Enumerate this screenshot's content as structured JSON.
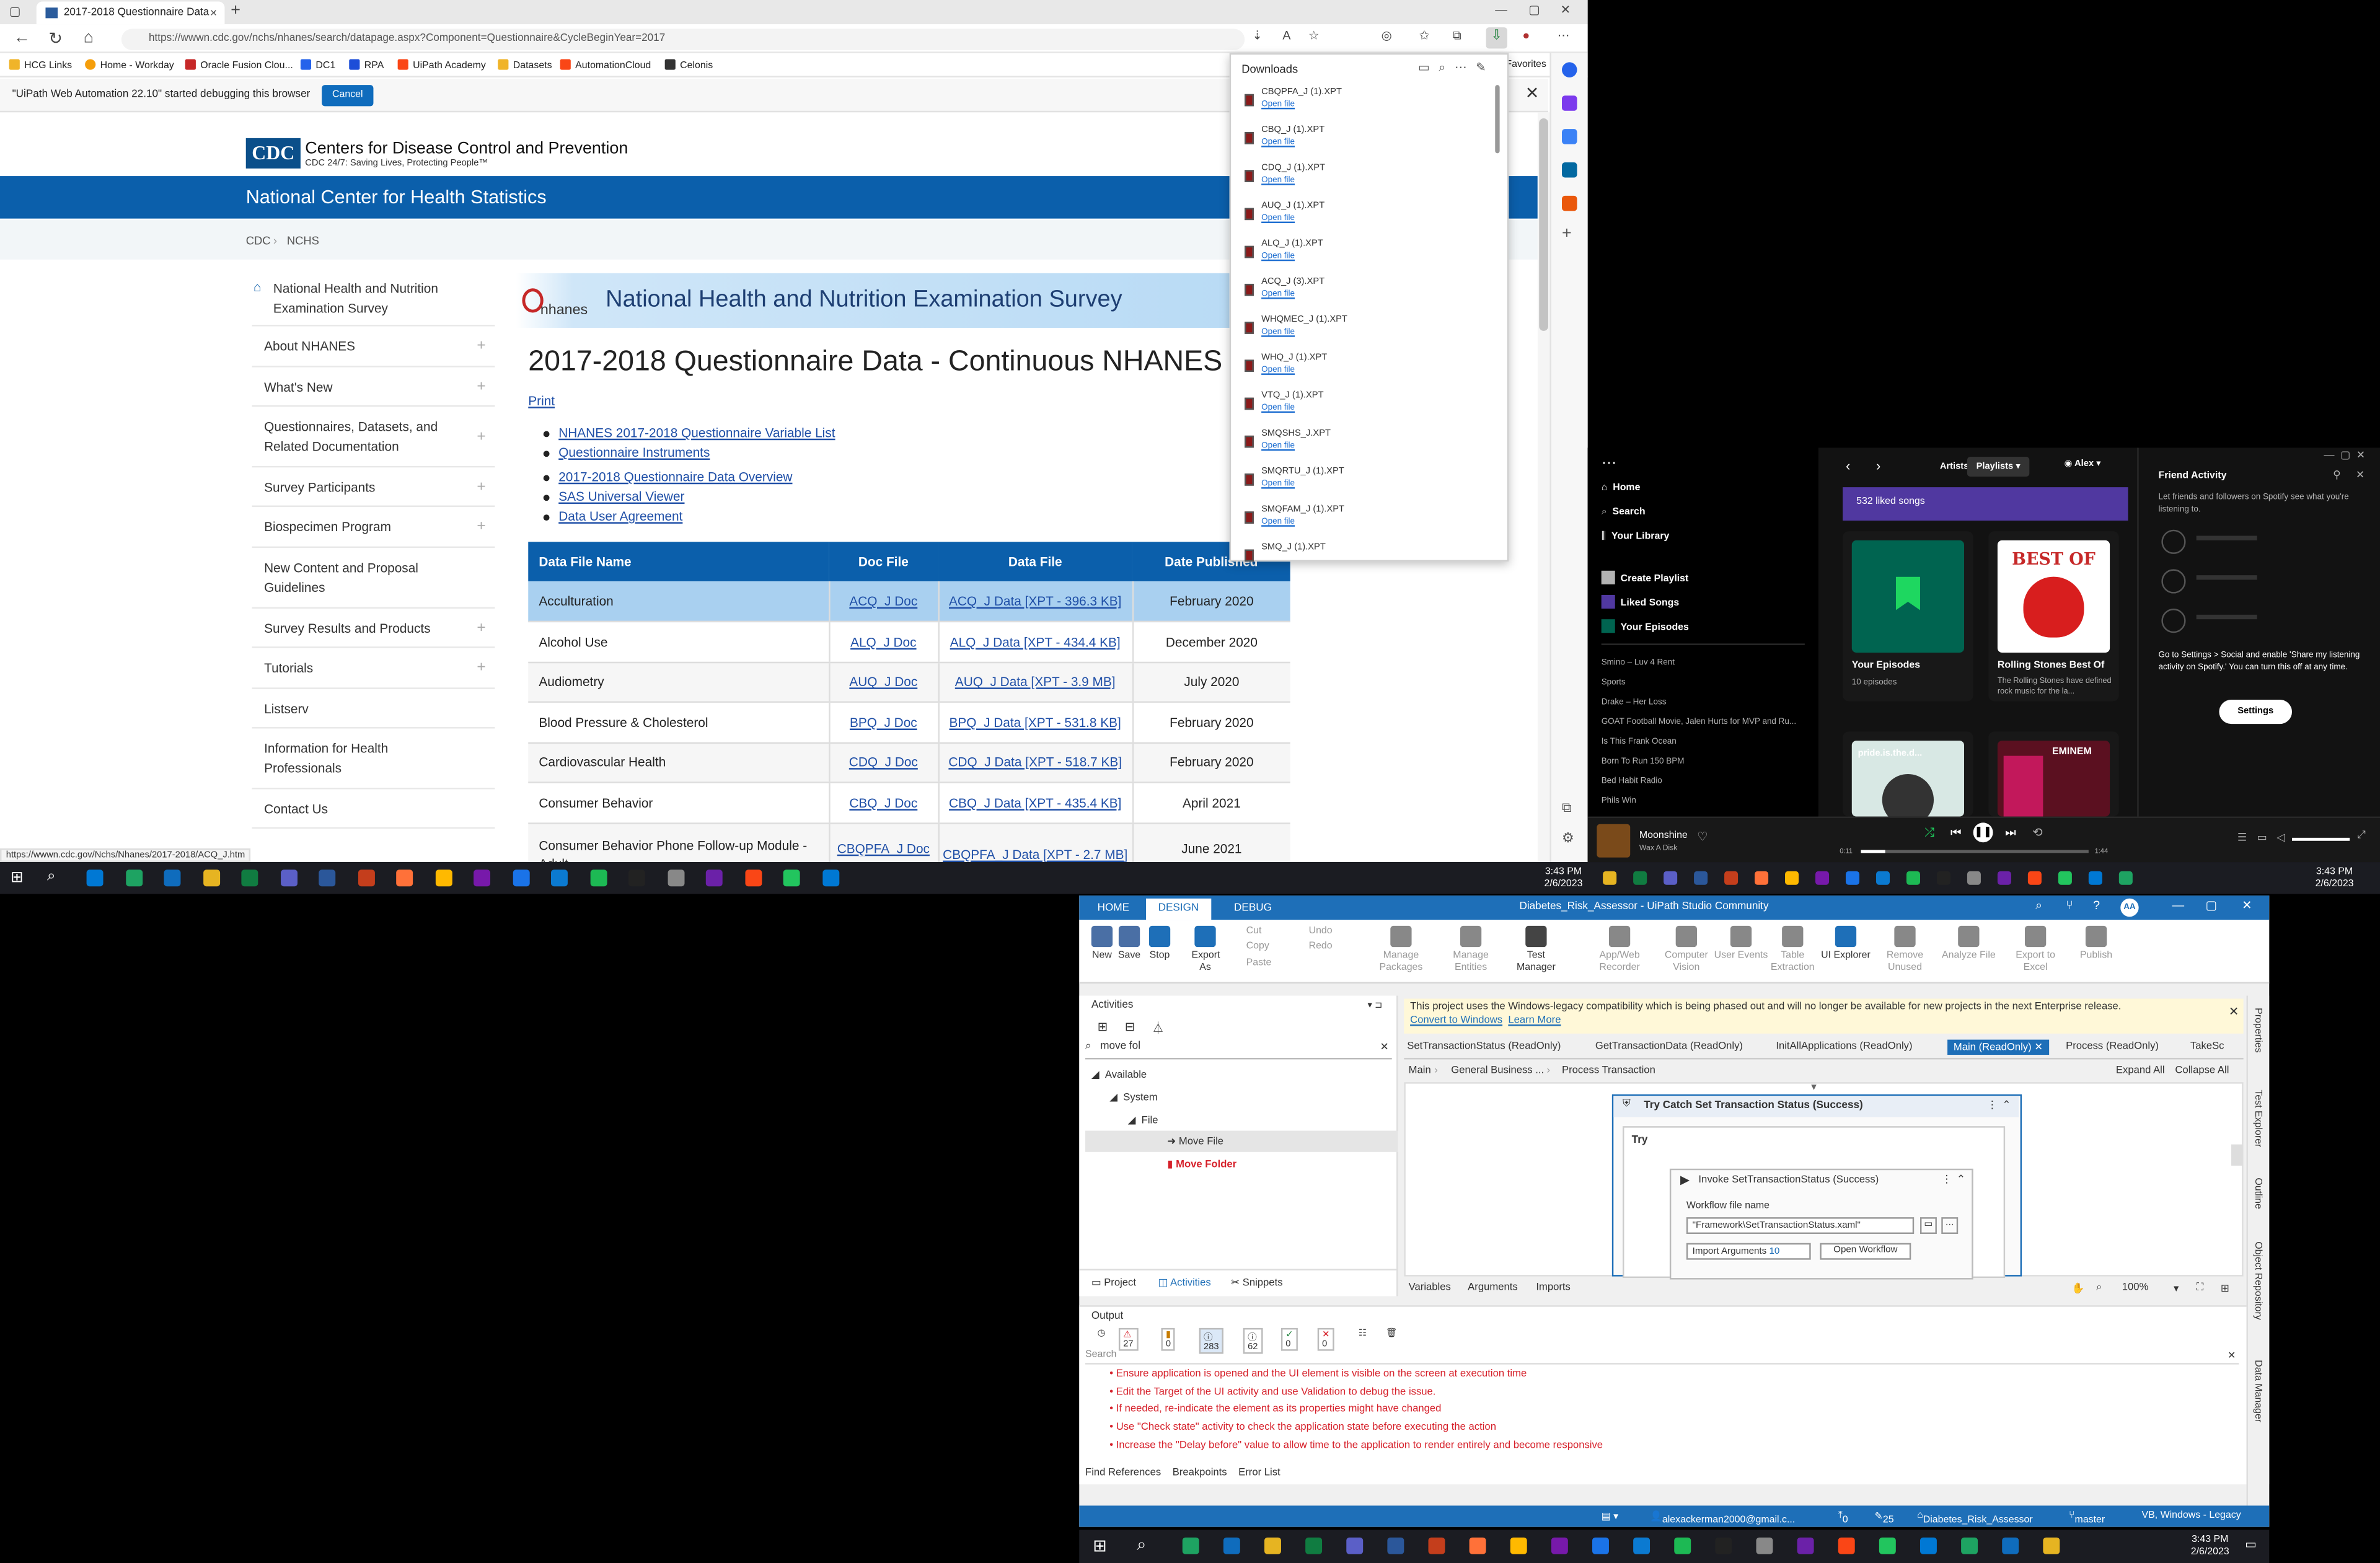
{
  "browser": {
    "tab_title": "2017-2018 Questionnaire Data -",
    "url": "https://wwwn.cdc.gov/nchs/nhanes/search/datapage.aspx?Component=Questionnaire&CycleBeginYear=2017",
    "bookmarks": [
      "HCG Links",
      "Home - Workday",
      "Oracle Fusion Clou...",
      "DC1",
      "RPA",
      "UiPath Academy",
      "Datasets",
      "AutomationCloud",
      "Celonis"
    ],
    "favorites_label": "Favorites",
    "infobar_message": "\"UiPath Web Automation 22.10\" started debugging this browser",
    "infobar_button": "Cancel",
    "status_url": "https://wwwn.cdc.gov/Nchs/Nhanes/2017-2018/ACQ_J.htm"
  },
  "downloads": {
    "title": "Downloads",
    "open_label": "Open file",
    "items": [
      "CBQPFA_J (1).XPT",
      "CBQ_J (1).XPT",
      "CDQ_J (1).XPT",
      "AUQ_J (1).XPT",
      "ALQ_J (1).XPT",
      "ACQ_J (3).XPT",
      "WHQMEC_J (1).XPT",
      "WHQ_J (1).XPT",
      "VTQ_J (1).XPT",
      "SMQSHS_J.XPT",
      "SMQRTU_J (1).XPT",
      "SMQFAM_J (1).XPT",
      "SMQ_J (1).XPT"
    ]
  },
  "page": {
    "cdc_logo": "CDC",
    "cdc_name": "Centers for Disease Control and Prevention",
    "cdc_tagline": "CDC 24/7: Saving Lives, Protecting People™",
    "nchs_title": "National Center for Health Statistics",
    "breadcrumb": [
      "CDC",
      "NCHS"
    ],
    "sidebar": [
      {
        "label": "National Health and Nutrition Examination Survey",
        "plus": ""
      },
      {
        "label": "About NHANES",
        "plus": "+"
      },
      {
        "label": "What's New",
        "plus": "+"
      },
      {
        "label": "Questionnaires, Datasets, and Related Documentation",
        "plus": "+"
      },
      {
        "label": "Survey Participants",
        "plus": "+"
      },
      {
        "label": "Biospecimen Program",
        "plus": "+"
      },
      {
        "label": "New Content and Proposal Guidelines",
        "plus": ""
      },
      {
        "label": "Survey Results and Products",
        "plus": "+"
      },
      {
        "label": "Tutorials",
        "plus": "+"
      },
      {
        "label": "Listserv",
        "plus": ""
      },
      {
        "label": "Information for Health Professionals",
        "plus": ""
      },
      {
        "label": "Contact Us",
        "plus": ""
      }
    ],
    "nhanes_logo_text": "nhanes",
    "banner_title": "National Health and Nutrition Examination Survey",
    "title": "2017-2018 Questionnaire Data - Continuous NHANES",
    "print_link": "Print",
    "links_group1": [
      "NHANES 2017-2018 Questionnaire Variable List",
      "Questionnaire Instruments"
    ],
    "links_group2": [
      "2017-2018 Questionnaire Data Overview",
      "SAS Universal Viewer",
      "Data User Agreement"
    ],
    "table_headers": [
      "Data File Name",
      "Doc File",
      "Data File",
      "Date Published"
    ],
    "table_rows": [
      {
        "name": "Acculturation",
        "doc": "ACQ_J Doc",
        "data": "ACQ_J Data [XPT - 396.3 KB]",
        "date": "February 2020"
      },
      {
        "name": "Alcohol Use",
        "doc": "ALQ_J Doc",
        "data": "ALQ_J Data [XPT - 434.4 KB]",
        "date": "December 2020"
      },
      {
        "name": "Audiometry",
        "doc": "AUQ_J Doc",
        "data": "AUQ_J Data [XPT - 3.9 MB]",
        "date": "July 2020"
      },
      {
        "name": "Blood Pressure & Cholesterol",
        "doc": "BPQ_J Doc",
        "data": "BPQ_J Data [XPT - 531.8 KB]",
        "date": "February 2020"
      },
      {
        "name": "Cardiovascular Health",
        "doc": "CDQ_J Doc",
        "data": "CDQ_J Data [XPT - 518.7 KB]",
        "date": "February 2020"
      },
      {
        "name": "Consumer Behavior",
        "doc": "CBQ_J Doc",
        "data": "CBQ_J Data [XPT - 435.4 KB]",
        "date": "April 2021"
      },
      {
        "name": "Consumer Behavior Phone Follow-up Module - Adult",
        "doc": "CBQPFA_J Doc",
        "data": "CBQPFA_J Data [XPT - 2.7 MB]",
        "date": "June 2021"
      }
    ]
  },
  "taskbar_top": {
    "time": "3:43 PM",
    "date": "2/6/2023"
  },
  "taskbar_bottom": {
    "time": "3:43 PM",
    "date": "2/6/2023"
  },
  "spotify": {
    "nav": [
      "Home",
      "Search",
      "Your Library"
    ],
    "actions": [
      "Create Playlist",
      "Liked Songs",
      "Your Episodes"
    ],
    "playlists": [
      "Smino – Luv 4 Rent",
      "Sports",
      "Drake – Her Loss",
      "GOAT Football Movie, Jalen Hurts for MVP and Ru...",
      "Is This Frank Ocean",
      "Born To Run 150 BPM",
      "Bed Habit Radio",
      "Phils Win"
    ],
    "top_tabs": [
      "Artists",
      "Playlists"
    ],
    "user": "Alex",
    "liked_songs": "532 liked songs",
    "card1_title": "Your Episodes",
    "card1_sub": "10 episodes",
    "card2_title": "Rolling Stones Best Of",
    "card2_sub": "The Rolling Stones have defined rock music for the la...",
    "card2_art": "BEST OF",
    "card3_art": "pride.is.the.d...",
    "card4_art": "EMINEM",
    "friend_title": "Friend Activity",
    "friend_text": "Let friends and followers on Spotify see what you're listening to.",
    "friend_settings_text": "Go to Settings > Social and enable 'Share my listening activity on Spotify.' You can turn this off at any time.",
    "settings_button": "Settings",
    "track": "Moonshine",
    "artist": "Wax A Disk",
    "elapsed": "0:11",
    "duration": "1:44"
  },
  "uipath": {
    "title": "Diabetes_Risk_Assessor - UiPath Studio Community",
    "tabs": [
      "HOME",
      "DESIGN",
      "DEBUG"
    ],
    "ribbon": [
      "New",
      "Save",
      "Stop",
      "Export As",
      "Cut",
      "Copy",
      "Paste",
      "Undo",
      "Redo",
      "Manage Packages",
      "Manage Entities",
      "Test Manager",
      "App/Web Recorder",
      "Computer Vision",
      "User Events",
      "Table Extraction",
      "UI Explorer",
      "Remove Unused",
      "Analyze File",
      "Export to Excel",
      "Publish"
    ],
    "activities_title": "Activities",
    "search_value": "move fol",
    "tree": [
      "Available",
      "System",
      "File",
      "Move File",
      "Move Folder"
    ],
    "bottom_tabs": [
      "Project",
      "Activities",
      "Snippets"
    ],
    "warning": "This project uses the Windows-legacy compatibility which is being phased out and will no longer be available for new projects in the next Enterprise release.",
    "warning_links": [
      "Convert to Windows",
      "Learn More"
    ],
    "doc_tabs": [
      "SetTransactionStatus (ReadOnly)",
      "GetTransactionData (ReadOnly)",
      "InitAllApplications (ReadOnly)",
      "Main (ReadOnly)",
      "Process (ReadOnly)",
      "TakeSc"
    ],
    "breadcrumb": [
      "Main",
      "General Business ...",
      "Process Transaction"
    ],
    "expand_all": "Expand All",
    "collapse_all": "Collapse All",
    "try_catch": "Try Catch Set Transaction Status (Success)",
    "try_label": "Try",
    "invoke": "Invoke SetTransactionStatus (Success)",
    "workflow_label": "Workflow file name",
    "workflow_value": "\"Framework\\SetTransactionStatus.xaml\"",
    "import_args": "Import Arguments",
    "import_count": "10",
    "open_workflow": "Open Workflow",
    "canvas_footer": [
      "Variables",
      "Arguments",
      "Imports"
    ],
    "zoom": "100%",
    "output_title": "Output",
    "counts": [
      "27",
      "0",
      "283",
      "62",
      "0",
      "0"
    ],
    "output_search": "Search",
    "errors": [
      "Ensure application is opened and the UI element is visible on the screen at execution time",
      "Edit the Target of the UI activity and use Validation to debug the issue.",
      "If needed, re-indicate the element as its properties might have changed",
      "Use \"Check state\" activity to check the application state before executing the action",
      "Increase the \"Delay before\" value to allow time to the application to render entirely and become responsive"
    ],
    "output_tabs": [
      "Find References",
      "Breakpoints",
      "Error List"
    ],
    "right_panel": [
      "Properties",
      "Test Explorer",
      "Outline",
      "Object Repository",
      "Data Manager"
    ],
    "status": [
      "alexackerman2000@gmail.c...",
      "0",
      "25",
      "Diabetes_Risk_Assessor",
      "master",
      "VB, Windows - Legacy"
    ]
  }
}
